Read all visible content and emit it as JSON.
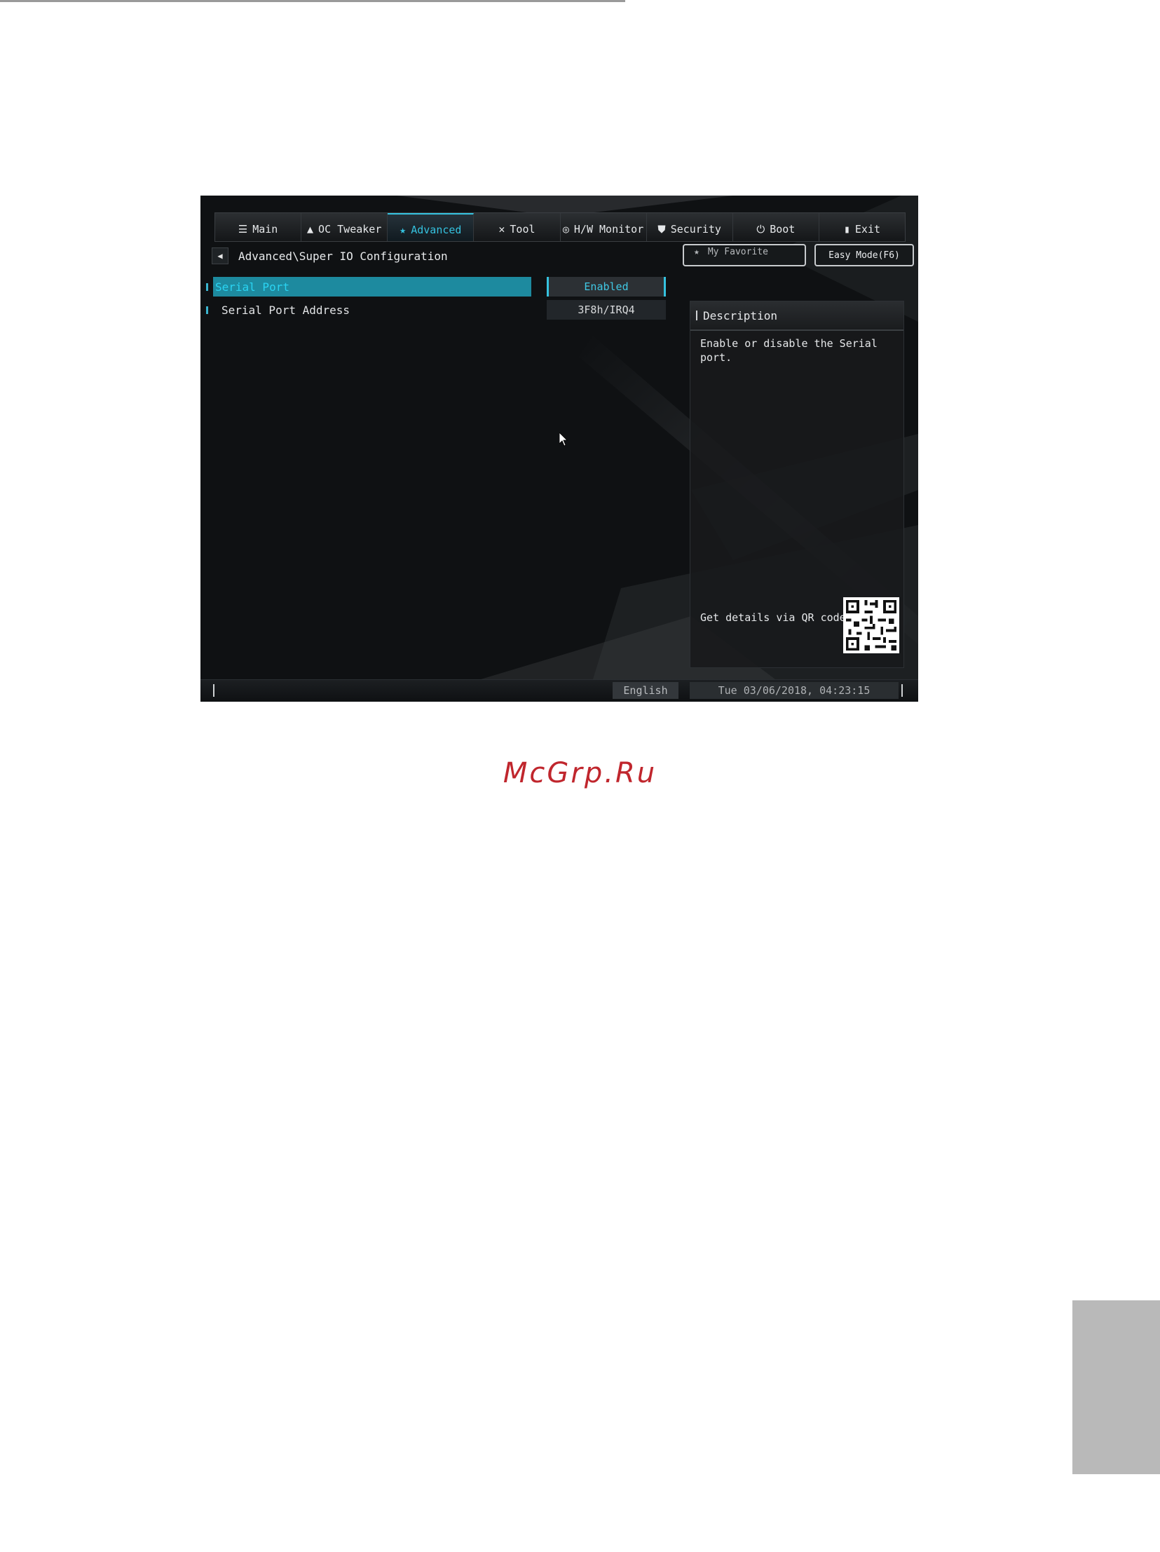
{
  "watermark": "McGrp.Ru",
  "bios": {
    "tabs": [
      {
        "label": "Main",
        "icon": "list-icon",
        "active": false
      },
      {
        "label": "OC Tweaker",
        "icon": "rocket-icon",
        "active": false
      },
      {
        "label": "Advanced",
        "icon": "star-icon",
        "active": true
      },
      {
        "label": "Tool",
        "icon": "tools-icon",
        "active": false
      },
      {
        "label": "H/W Monitor",
        "icon": "globe-icon",
        "active": false
      },
      {
        "label": "Security",
        "icon": "shield-icon",
        "active": false
      },
      {
        "label": "Boot",
        "icon": "power-icon",
        "active": false
      },
      {
        "label": "Exit",
        "icon": "exit-icon",
        "active": false
      }
    ],
    "breadcrumb": "Advanced\\Super IO Configuration",
    "my_favorite": "My Favorite",
    "easy_mode": "Easy Mode(F6)",
    "items": [
      {
        "label": "Serial Port",
        "value": "Enabled",
        "selected": true
      },
      {
        "label": "Serial Port Address",
        "value": "3F8h/IRQ4",
        "selected": false
      }
    ],
    "description": {
      "title": "Description",
      "text": "Enable or disable the Serial port.",
      "qr_label": "Get details via QR code"
    },
    "status": {
      "language": "English",
      "datetime": "Tue 03/06/2018, 04:23:15"
    },
    "colors": {
      "accent": "#35c2df",
      "selected_row": "#1d8a9f",
      "background": "#101214"
    }
  }
}
